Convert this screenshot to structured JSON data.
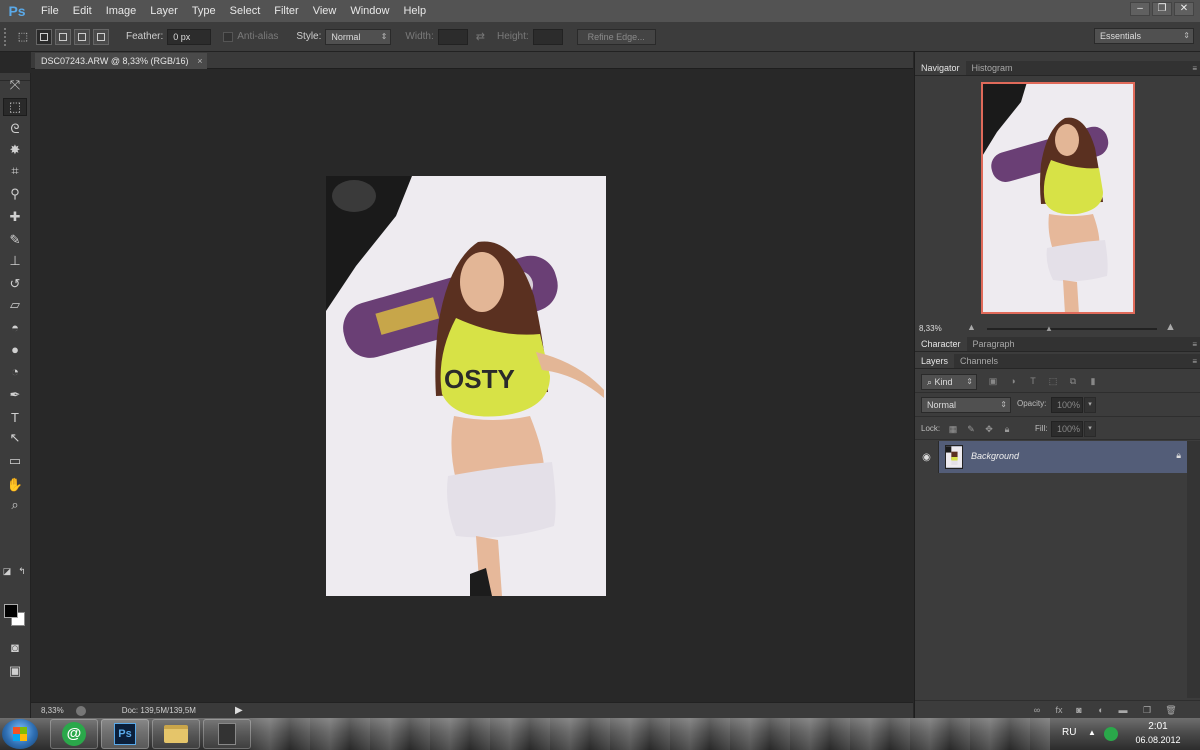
{
  "app": {
    "logo": "Ps"
  },
  "menu": [
    "File",
    "Edit",
    "Image",
    "Layer",
    "Type",
    "Select",
    "Filter",
    "View",
    "Window",
    "Help"
  ],
  "window_controls": {
    "minimize": "–",
    "restore": "❐",
    "close": "✕"
  },
  "options_bar": {
    "feather_label": "Feather:",
    "feather_value": "0 px",
    "anti_alias_label": "Anti-alias",
    "style_label": "Style:",
    "style_value": "Normal",
    "width_label": "Width:",
    "height_label": "Height:",
    "refine_edge_label": "Refine Edge...",
    "workspace_value": "Essentials"
  },
  "document": {
    "tab_title": "DSC07243.ARW @ 8,33% (RGB/16)",
    "tab_close": "×",
    "zoom": "8,33%",
    "doc_info": "Doc: 139,5M/139,5M",
    "status_arrow": "▶"
  },
  "tools": [
    {
      "name": "move-tool-icon",
      "glyph": "⤧"
    },
    {
      "name": "marquee-tool-icon",
      "glyph": "⬚"
    },
    {
      "name": "lasso-tool-icon",
      "glyph": "ᘓ"
    },
    {
      "name": "quick-select-tool-icon",
      "glyph": "✸"
    },
    {
      "name": "crop-tool-icon",
      "glyph": "⌗"
    },
    {
      "name": "eyedropper-tool-icon",
      "glyph": "⚲"
    },
    {
      "name": "healing-brush-tool-icon",
      "glyph": "✚"
    },
    {
      "name": "brush-tool-icon",
      "glyph": "✎"
    },
    {
      "name": "clone-stamp-tool-icon",
      "glyph": "⊥"
    },
    {
      "name": "history-brush-tool-icon",
      "glyph": "↺"
    },
    {
      "name": "eraser-tool-icon",
      "glyph": "▱"
    },
    {
      "name": "paint-bucket-tool-icon",
      "glyph": "◓"
    },
    {
      "name": "blur-tool-icon",
      "glyph": "●"
    },
    {
      "name": "dodge-tool-icon",
      "glyph": "◔"
    },
    {
      "name": "pen-tool-icon",
      "glyph": "✒"
    },
    {
      "name": "type-tool-icon",
      "glyph": "T"
    },
    {
      "name": "path-select-tool-icon",
      "glyph": "↖"
    },
    {
      "name": "rectangle-tool-icon",
      "glyph": "▭"
    },
    {
      "name": "hand-tool-icon",
      "glyph": "✋"
    },
    {
      "name": "zoom-tool-icon",
      "glyph": "⌕"
    }
  ],
  "navigator": {
    "tabs": [
      "Navigator",
      "Histogram"
    ],
    "zoom": "8,33%",
    "menu_glyph": "≡"
  },
  "character_panel": {
    "tabs": [
      "Character",
      "Paragraph"
    ]
  },
  "layers_panel": {
    "tabs": [
      "Layers",
      "Channels"
    ],
    "filter_kind": "Kind",
    "blend_mode": "Normal",
    "opacity_label": "Opacity:",
    "opacity_value": "100%",
    "lock_label": "Lock:",
    "fill_label": "Fill:",
    "fill_value": "100%",
    "layers": [
      {
        "name": "Background",
        "visible": true,
        "locked": true
      }
    ],
    "bottom_icons": [
      "link-icon",
      "fx-icon",
      "mask-icon",
      "adjustment-icon",
      "group-icon",
      "new-layer-icon",
      "trash-icon"
    ]
  },
  "taskbar": {
    "lang": "RU",
    "time": "2:01",
    "date": "06.08.2012",
    "tray_up": "▲"
  },
  "colors": {
    "accent_selection": "#535d78",
    "panel": "#3c3c3c",
    "canvas_bg": "#282828",
    "nav_frame": "#e06a5a"
  }
}
